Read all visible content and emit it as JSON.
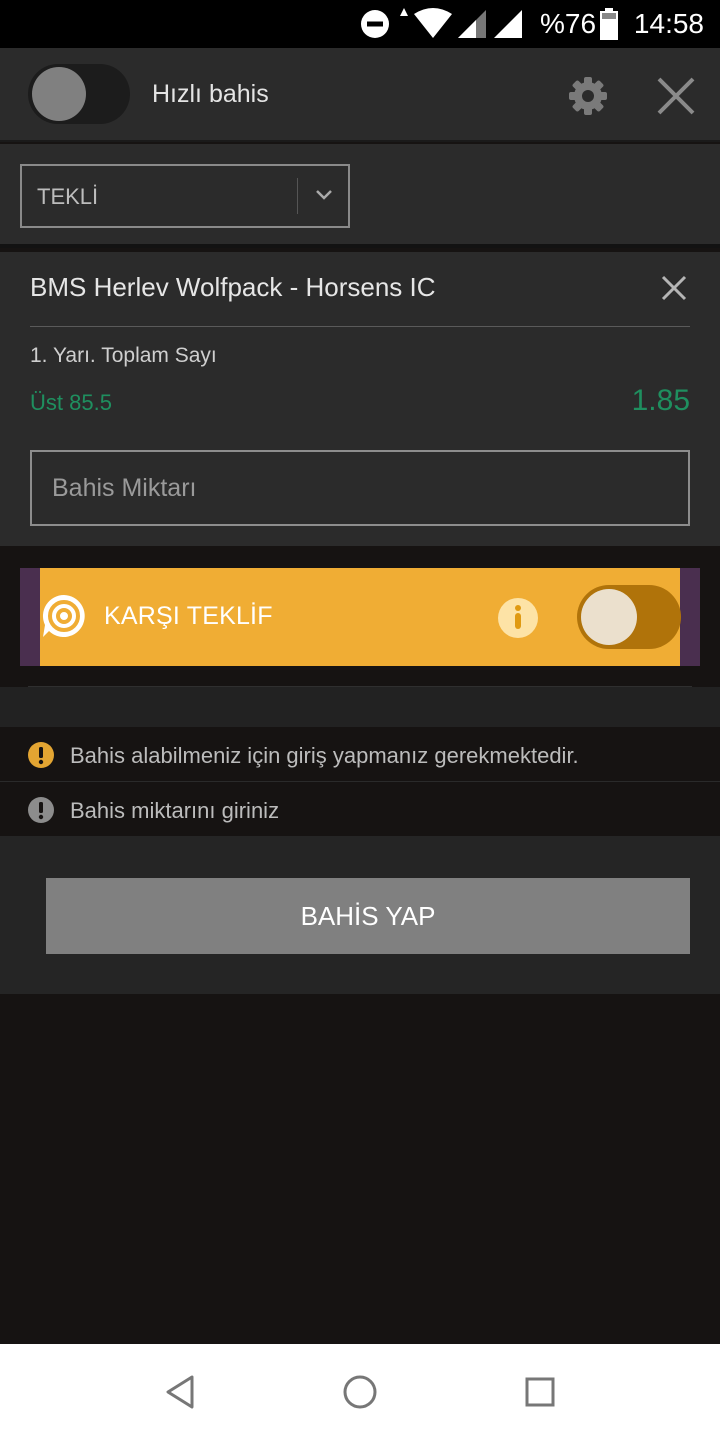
{
  "status_bar": {
    "battery_percent": "%76",
    "time": "14:58",
    "icons": [
      "do-not-disturb-icon",
      "wifi-icon",
      "signal-icon",
      "signal-icon",
      "battery-icon"
    ]
  },
  "header": {
    "quick_bet_label": "Hızlı bahis",
    "quick_bet_enabled": false,
    "settings_icon": "gear-icon",
    "close_icon": "close-icon"
  },
  "bet_type": {
    "selected": "TEKLİ",
    "chevron_icon": "chevron-down-icon"
  },
  "bet": {
    "match": "BMS Herlev Wolfpack - Horsens IC",
    "market": "1. Yarı. Toplam Sayı",
    "selection": "Üst 85.5",
    "odds": "1.85",
    "stake_placeholder": "Bahis Miktarı"
  },
  "counter_offer": {
    "label": "KARŞI TEKLİF",
    "enabled": false,
    "info_icon": "info-icon"
  },
  "warnings": [
    {
      "text": "Bahis alabilmeniz için giriş yapmanız gerekmektedir.",
      "color": "#e3a532"
    },
    {
      "text": "Bahis miktarını giriniz",
      "color": "#8c8c8c"
    }
  ],
  "place_bet_label": "BAHİS YAP",
  "colors": {
    "odds_green": "#1f8f5f",
    "counter_bg": "#f0ad34",
    "counter_edge": "#4a2f4f"
  },
  "nav": {
    "icons": [
      "back-icon",
      "home-icon",
      "recents-icon"
    ]
  }
}
